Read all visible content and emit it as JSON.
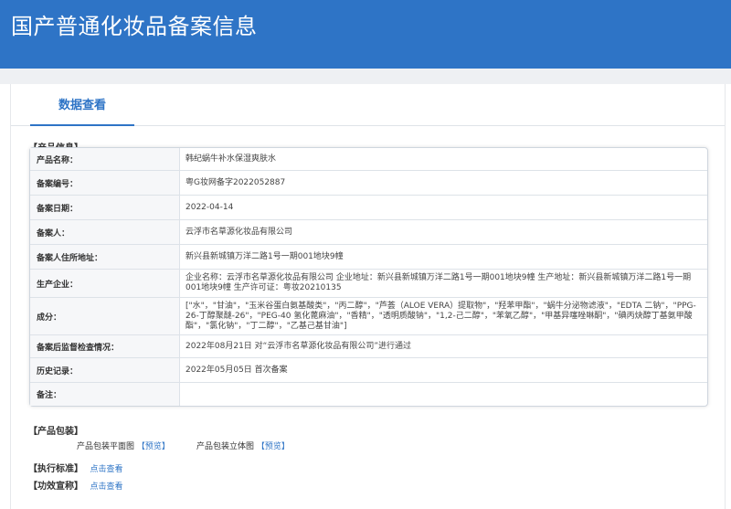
{
  "header": {
    "title": "国产普通化妆品备案信息"
  },
  "tabs": [
    {
      "label": "数据查看"
    }
  ],
  "product_info": {
    "section_title": "【产品信息】",
    "rows": [
      {
        "label": "产品名称：",
        "value": "韩纪蜗牛补水保湿爽肤水"
      },
      {
        "label": "备案编号：",
        "value": "粤G妆网备字2022052887"
      },
      {
        "label": "备案日期：",
        "value": "2022-04-14"
      },
      {
        "label": "备案人：",
        "value": "云浮市名草源化妆品有限公司"
      },
      {
        "label": "备案人住所地址：",
        "value": "新兴县新城镇万洋二路1号一期001地块9幢"
      },
      {
        "label": "生产企业：",
        "value": "企业名称：云浮市名草源化妆品有限公司 企业地址：新兴县新城镇万洋二路1号一期001地块9幢 生产地址：新兴县新城镇万洋二路1号一期001地块9幢 生产许可证：粤妆20210135"
      },
      {
        "label": "成分：",
        "value": "[\"水\"，\"甘油\"，\"玉米谷蛋白氨基酸类\"，\"丙二醇\"，\"芦荟（ALOE VERA）提取物\"，\"羟苯甲酯\"，\"蜗牛分泌物滤液\"，\"EDTA 二钠\"，\"PPG-26-丁醇聚醚-26\"，\"PEG-40 氢化蓖麻油\"，\"香精\"，\"透明质酸钠\"，\"1,2-己二醇\"，\"苯氧乙醇\"，\"甲基异噻唑啉酮\"，\"碘丙炔醇丁基氨甲酸酯\"，\"氯化钠\"，\"丁二醇\"，\"乙基己基甘油\"]"
      },
      {
        "label": "备案后监督检查情况：",
        "value": "2022年08月21日 对“云浮市名草源化妆品有限公司”进行通过"
      },
      {
        "label": "历史记录：",
        "value": "2022年05月05日 首次备案"
      },
      {
        "label": "备注：",
        "value": ""
      }
    ]
  },
  "packaging": {
    "section_title": "【产品包装】",
    "flat_label": "产品包装平面图",
    "flat_link": "【预览】",
    "solid_label": "产品包装立体图",
    "solid_link": "【预览】"
  },
  "standard": {
    "section_title": "【执行标准】",
    "link": "点击查看"
  },
  "efficacy": {
    "section_title": "【功效宣称】",
    "link": "点击查看"
  }
}
